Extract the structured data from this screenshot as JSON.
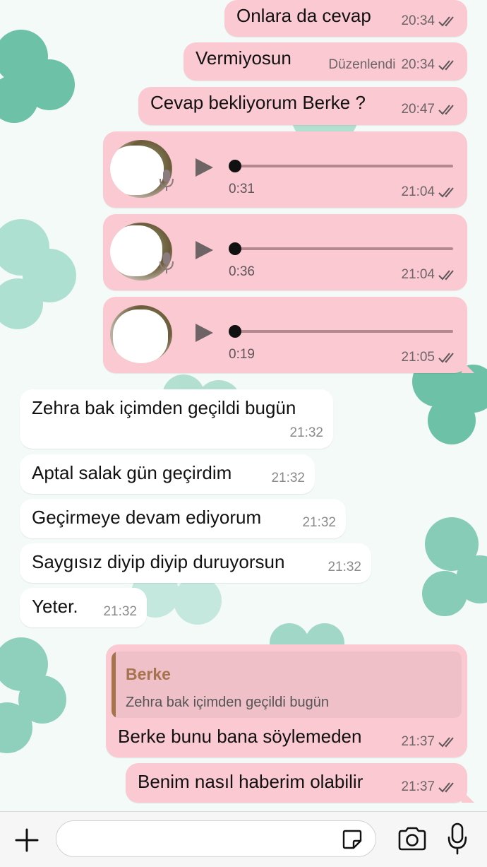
{
  "messages": [
    {
      "type": "text",
      "dir": "out",
      "text": "Onlara da cevap",
      "time": "20:34",
      "status": "read"
    },
    {
      "type": "text",
      "dir": "out",
      "text": "Vermiyosun",
      "edited": "Düzenlendi",
      "time": "20:34",
      "status": "read"
    },
    {
      "type": "text",
      "dir": "out",
      "text": "Cevap bekliyorum Berke ?",
      "time": "20:47",
      "status": "read"
    },
    {
      "type": "voice",
      "dir": "out",
      "duration": "0:31",
      "time": "21:04",
      "status": "read"
    },
    {
      "type": "voice",
      "dir": "out",
      "duration": "0:36",
      "time": "21:04",
      "status": "read"
    },
    {
      "type": "voice",
      "dir": "out",
      "duration": "0:19",
      "time": "21:05",
      "status": "read"
    },
    {
      "type": "text",
      "dir": "in",
      "text": "Zehra bak içimden geçildi bugün",
      "time": "21:32"
    },
    {
      "type": "text",
      "dir": "in",
      "text": "Aptal salak gün geçirdim",
      "time": "21:32"
    },
    {
      "type": "text",
      "dir": "in",
      "text": "Geçirmeye devam ediyorum",
      "time": "21:32"
    },
    {
      "type": "text",
      "dir": "in",
      "text": "Saygısız diyip diyip duruyorsun",
      "time": "21:32"
    },
    {
      "type": "text",
      "dir": "in",
      "text": "Yeter.",
      "time": "21:32"
    },
    {
      "type": "reply",
      "dir": "out",
      "quote_author": "Berke",
      "quote_text": "Zehra bak içimden geçildi bugün",
      "text": "Berke bunu bana söylemeden",
      "time": "21:37",
      "status": "read"
    },
    {
      "type": "text",
      "dir": "out",
      "text": "Benim nasıl haberim olabilir",
      "time": "21:37",
      "status": "read"
    }
  ],
  "composer": {
    "placeholder": "",
    "icons": [
      "plus-icon",
      "sticker-icon",
      "camera-icon",
      "microphone-icon"
    ]
  },
  "colors": {
    "outgoing_bubble": "#fbc9d2",
    "incoming_bubble": "#ffffff",
    "quote_accent": "#a5744e",
    "wallpaper_clover": "#3fae8c"
  }
}
